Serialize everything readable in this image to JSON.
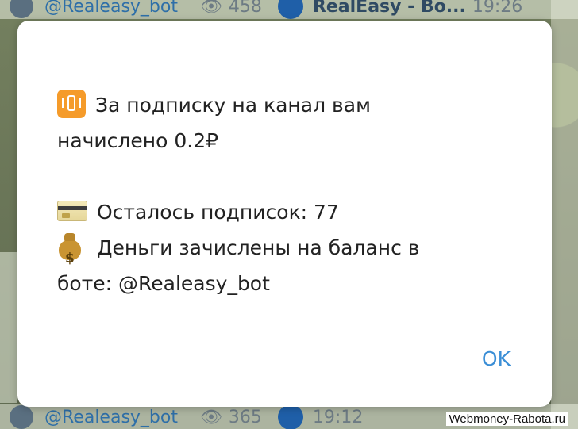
{
  "background_chat": {
    "top_row": {
      "bot_handle": "@Realeasy_bot",
      "views": "458",
      "channel_name": "RealEasy - Bo...",
      "time": "19:26"
    },
    "bottom_row": {
      "bot_handle": "@Realeasy_bot",
      "views": "365",
      "time": "19:12"
    }
  },
  "dialog": {
    "line1": "За подписку на канал вам",
    "line2": "начислено 0.2₽",
    "line3": "Осталось подписок: 77",
    "line4": "Деньги зачислены на баланс в",
    "line5": "боте: @Realeasy_bot",
    "ok_label": "OK"
  },
  "icons": {
    "line1": "vibration-mode-icon",
    "line3": "credit-card-icon",
    "line4": "money-bag-icon"
  },
  "colors": {
    "accent": "#3a8ed6",
    "text": "#222222",
    "dialog_bg": "#ffffff"
  },
  "watermark": "Webmoney-Rabota.ru"
}
